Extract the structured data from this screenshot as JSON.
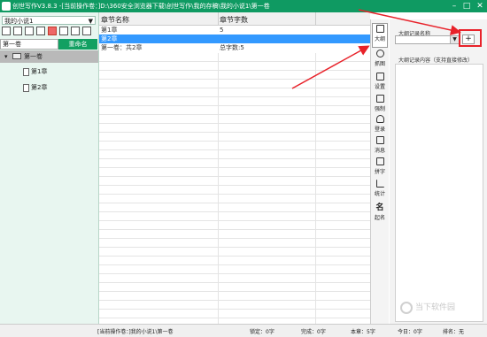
{
  "window": {
    "title": "创世写作V3.8.3 -[当前操作卷：]D:\\360安全浏览器下载\\创世写作\\我的存稿\\我的小说1\\第一卷"
  },
  "left": {
    "book_select": "我的小说1",
    "volume_input": "第一卷",
    "rename_label": "重命名",
    "tree": {
      "volume": "第一卷",
      "chapters": [
        "第1章",
        "第2章"
      ]
    }
  },
  "grid": {
    "headers": [
      "章节名称",
      "章节字数"
    ],
    "rows": [
      {
        "name": "第1章",
        "count": "5",
        "selected": false
      },
      {
        "name": "第2章",
        "count": "",
        "selected": true
      },
      {
        "name": "第一卷：共2章",
        "count": "总字数:5",
        "selected": false
      }
    ]
  },
  "right_toolbar": [
    {
      "label": "大纲",
      "icon": "outline-icon"
    },
    {
      "label": "抓图",
      "icon": "capture-icon"
    },
    {
      "label": "设置",
      "icon": "settings-icon"
    },
    {
      "label": "强制",
      "icon": "force-icon"
    },
    {
      "label": "登录",
      "icon": "user-icon"
    },
    {
      "label": "消息",
      "icon": "speaker-icon"
    },
    {
      "label": "拼字",
      "icon": "spell-icon"
    },
    {
      "label": "统计",
      "icon": "chart-icon"
    },
    {
      "label": "起名",
      "icon": "name-icon",
      "glyph": "名"
    }
  ],
  "outline_panel": {
    "name_label": "大纲记录名称",
    "plus_label": "+",
    "content_label": "大纲记录内容（支持直接修改）"
  },
  "status": {
    "current_volume": "[当前操作卷：]我的小说1\\第一卷",
    "locked": "锁定：0字",
    "done": "完成：0字",
    "chapter": "本章：5字",
    "today": "今日：0字",
    "rank": "排名：无"
  },
  "watermark": "当下软件园",
  "colors": {
    "titlebar": "#0f9a62",
    "accent": "#12a062",
    "selection": "#3399ff",
    "annotation": "#e8222a"
  }
}
